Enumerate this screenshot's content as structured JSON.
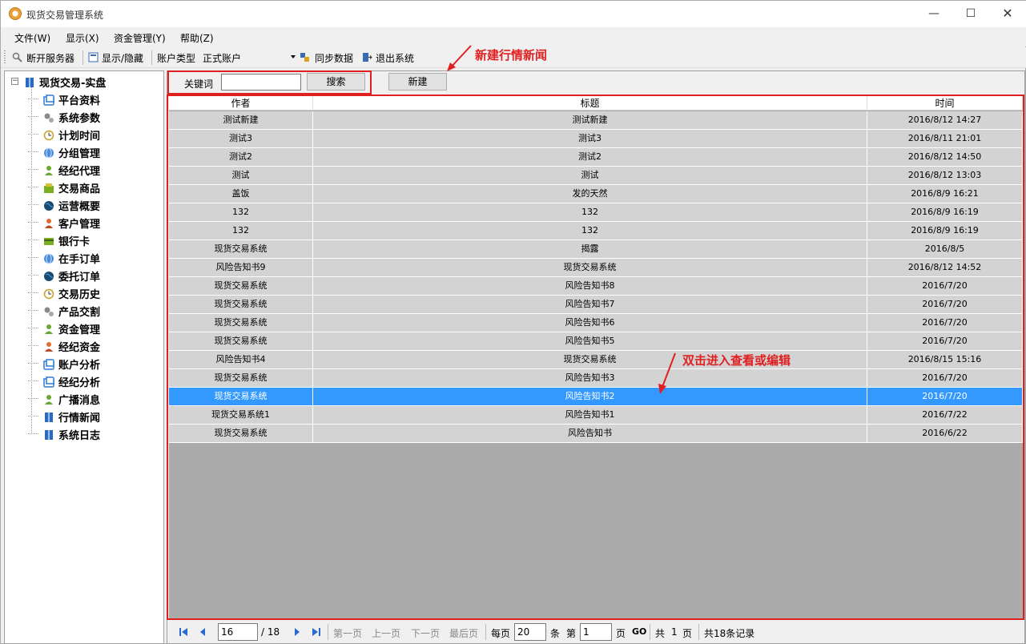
{
  "window": {
    "title": "现货交易管理系统",
    "minimize": "—",
    "maximize": "☐",
    "close": "✕"
  },
  "menu": [
    "文件(W)",
    "显示(X)",
    "资金管理(Y)",
    "帮助(Z)"
  ],
  "toolbar": {
    "disconnect": "断开服务器",
    "toggle_display": "显示/隐藏",
    "account_type_label": "账户类型",
    "account_type_value": "正式账户",
    "sync": "同步数据",
    "exit": "退出系统"
  },
  "tree": {
    "root": "现货交易-实盘",
    "items": [
      {
        "label": "平台资料",
        "icon": "window-icon",
        "color": "#2a7ad5"
      },
      {
        "label": "系统参数",
        "icon": "gears-icon",
        "color": "#8a8a8a"
      },
      {
        "label": "计划时间",
        "icon": "clock-icon",
        "color": "#c8a020"
      },
      {
        "label": "分组管理",
        "icon": "globe-icon",
        "color": "#4a8ee0"
      },
      {
        "label": "经纪代理",
        "icon": "user-icon",
        "color": "#6aa830"
      },
      {
        "label": "交易商品",
        "icon": "box-icon",
        "color": "#7ab020"
      },
      {
        "label": "运营概要",
        "icon": "earth-icon",
        "color": "#1a4a70"
      },
      {
        "label": "客户管理",
        "icon": "person-icon",
        "color": "#e06a30"
      },
      {
        "label": "银行卡",
        "icon": "card-icon",
        "color": "#7ab020"
      },
      {
        "label": "在手订单",
        "icon": "globe-icon",
        "color": "#4a8ee0"
      },
      {
        "label": "委托订单",
        "icon": "earth-icon",
        "color": "#1a4a70"
      },
      {
        "label": "交易历史",
        "icon": "clock-icon",
        "color": "#c8a020"
      },
      {
        "label": "产品交割",
        "icon": "gears-icon",
        "color": "#8a8a8a"
      },
      {
        "label": "资金管理",
        "icon": "user-icon",
        "color": "#6aa830"
      },
      {
        "label": "经纪资金",
        "icon": "person-icon",
        "color": "#e06a30"
      },
      {
        "label": "账户分析",
        "icon": "window-icon",
        "color": "#2a7ad5"
      },
      {
        "label": "经纪分析",
        "icon": "window-icon",
        "color": "#2a7ad5"
      },
      {
        "label": "广播消息",
        "icon": "user-icon",
        "color": "#6aa830"
      },
      {
        "label": "行情新闻",
        "icon": "book-icon",
        "color": "#2a6ac0"
      },
      {
        "label": "系统日志",
        "icon": "book-icon",
        "color": "#2a6ac0"
      }
    ]
  },
  "search": {
    "keyword_label": "关键词",
    "keyword_value": "",
    "search_button": "搜索",
    "new_button": "新建"
  },
  "grid": {
    "columns": [
      "作者",
      "标题",
      "时间"
    ],
    "rows": [
      [
        "测试新建",
        "测试新建",
        "2016/8/12 14:27"
      ],
      [
        "测试3",
        "测试3",
        "2016/8/11 21:01"
      ],
      [
        "测试2",
        "测试2",
        "2016/8/12 14:50"
      ],
      [
        "测试",
        "测试",
        "2016/8/12 13:03"
      ],
      [
        "盖饭",
        "发的天然",
        "2016/8/9 16:21"
      ],
      [
        "132",
        "132",
        "2016/8/9 16:19"
      ],
      [
        "132",
        "132",
        "2016/8/9 16:19"
      ],
      [
        "现货交易系统",
        "揭露",
        "2016/8/5"
      ],
      [
        "风险告知书9",
        "现货交易系统",
        "2016/8/12 14:52"
      ],
      [
        "现货交易系统",
        "风险告知书8",
        "2016/7/20"
      ],
      [
        "现货交易系统",
        "风险告知书7",
        "2016/7/20"
      ],
      [
        "现货交易系统",
        "风险告知书6",
        "2016/7/20"
      ],
      [
        "现货交易系统",
        "风险告知书5",
        "2016/7/20"
      ],
      [
        "风险告知书4",
        "现货交易系统",
        "2016/8/15 15:16"
      ],
      [
        "现货交易系统",
        "风险告知书3",
        "2016/7/20"
      ],
      [
        "现货交易系统",
        "风险告知书2",
        "2016/7/20"
      ],
      [
        "现货交易系统1",
        "风险告知书1",
        "2016/7/22"
      ],
      [
        "现货交易系统",
        "风险告知书",
        "2016/6/22"
      ]
    ],
    "selected_row": 15
  },
  "pager": {
    "current_page": "16",
    "total_pages": "/ 18",
    "first": "第一页",
    "prev": "上一页",
    "next": "下一页",
    "last": "最后页",
    "per_page_label": "每页",
    "per_page_value": "20",
    "per_page_unit": "条",
    "goto_label": "第",
    "goto_value": "1",
    "goto_unit": "页",
    "go": "GO",
    "total_prefix": "共",
    "total_pages_value": "1",
    "total_unit": "页",
    "total_records": "共18条记录"
  },
  "annotations": {
    "new_news": "新建行情新闻",
    "double_click": "双击进入查看或编辑"
  }
}
